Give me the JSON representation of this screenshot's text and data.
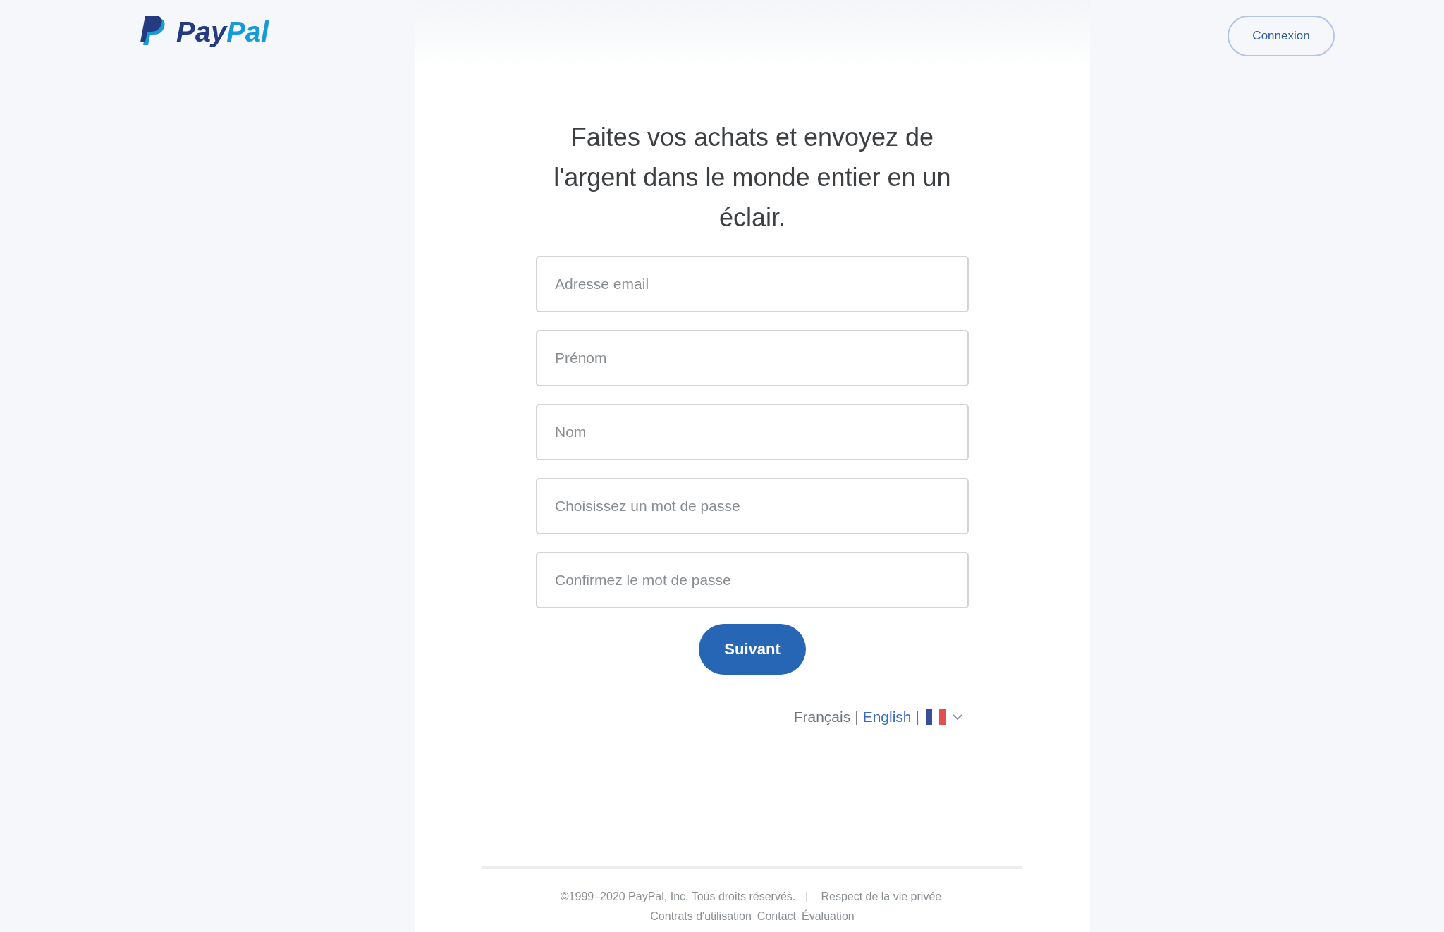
{
  "header": {
    "logo": [
      "Pay",
      "Pal"
    ],
    "login_button": "Connexion"
  },
  "signup": {
    "headline": "Faites vos achats et envoyez de l'argent dans le monde entier en un éclair.",
    "fields": [
      {
        "placeholder": "Adresse email"
      },
      {
        "placeholder": "Prénom"
      },
      {
        "placeholder": "Nom"
      },
      {
        "placeholder": "Choisissez un mot de passe"
      },
      {
        "placeholder": "Confirmez le mot de passe"
      }
    ],
    "next_button": "Suivant",
    "languages": [
      {
        "label": "Français",
        "selected": true
      },
      {
        "label": "English",
        "selected": false
      }
    ],
    "separator": "|"
  },
  "footer": {
    "copyright": "©1999–2020 PayPal, Inc. Tous droits réservés.",
    "separator": "|",
    "links_line_1": [
      "Respect de la vie privée"
    ],
    "links_line_2": [
      "Contrats d'utilisation",
      "Contact",
      "Évaluation"
    ]
  }
}
